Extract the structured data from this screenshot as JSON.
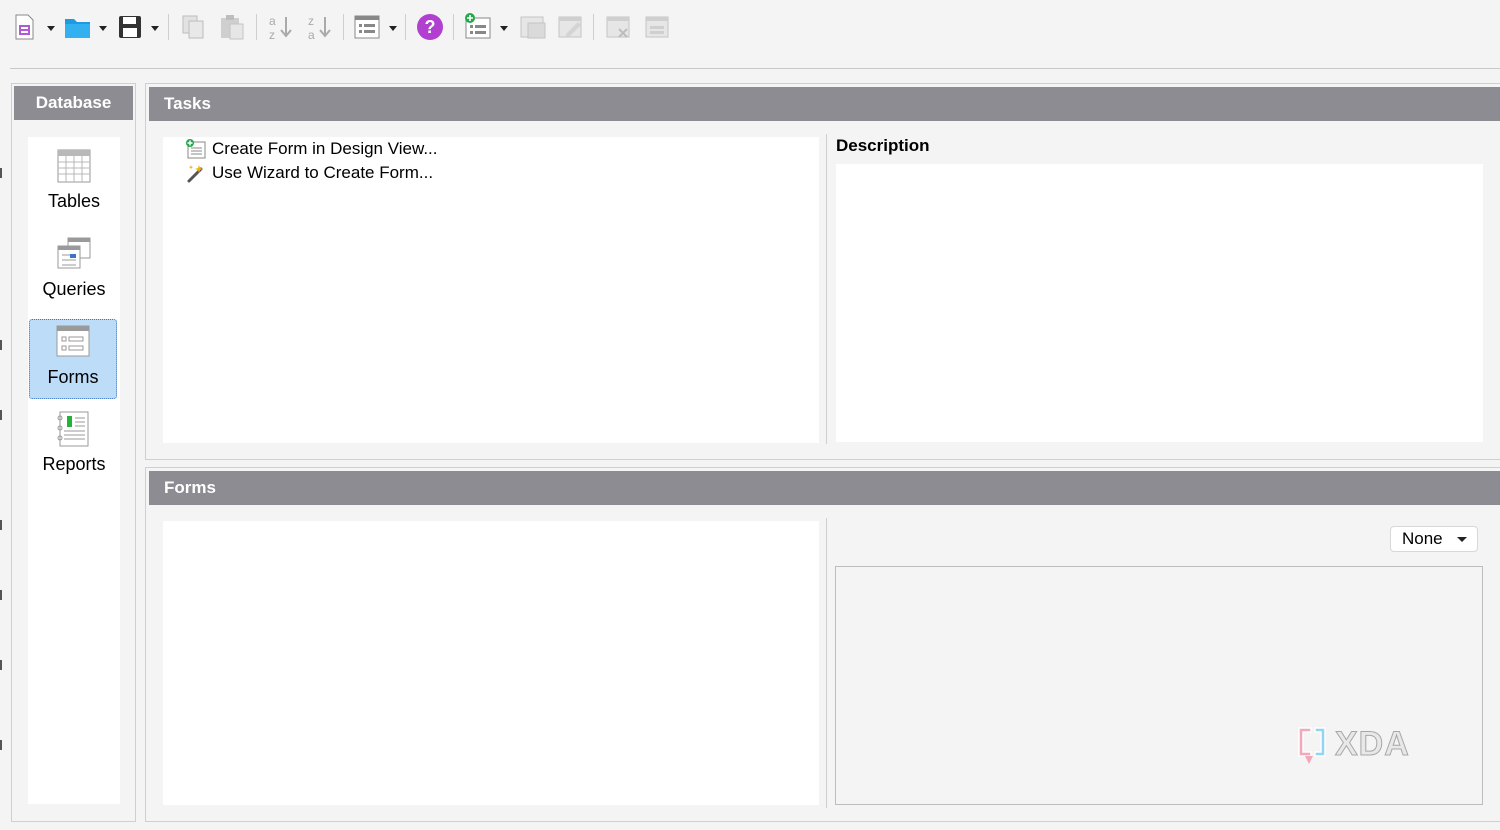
{
  "toolbar": {
    "buttons": [
      {
        "name": "new-document",
        "icon": "new-document-icon",
        "has_dropdown": true
      },
      {
        "name": "open",
        "icon": "folder-icon",
        "has_dropdown": true
      },
      {
        "name": "save",
        "icon": "floppy-disk-icon",
        "has_dropdown": true
      },
      {
        "name": "copy",
        "icon": "copy-icon",
        "enabled": false
      },
      {
        "name": "paste",
        "icon": "paste-icon",
        "enabled": false
      },
      {
        "name": "sort-ascending",
        "icon": "sort-az-icon",
        "enabled": false
      },
      {
        "name": "sort-descending",
        "icon": "sort-za-icon",
        "enabled": false
      },
      {
        "name": "new-form",
        "icon": "form-icon",
        "has_dropdown": true
      },
      {
        "name": "help",
        "icon": "help-icon"
      },
      {
        "name": "new-form-object",
        "icon": "form-add-icon",
        "has_dropdown": true
      },
      {
        "name": "open-form",
        "icon": "form-open-icon",
        "enabled": false
      },
      {
        "name": "edit-form",
        "icon": "form-edit-icon",
        "enabled": false
      },
      {
        "name": "delete-form",
        "icon": "form-delete-icon",
        "enabled": false
      },
      {
        "name": "rename-form",
        "icon": "form-rename-icon",
        "enabled": false
      }
    ]
  },
  "database": {
    "title": "Database",
    "items": [
      {
        "label": "Tables",
        "icon": "table-icon",
        "selected": false
      },
      {
        "label": "Queries",
        "icon": "query-icon",
        "selected": false
      },
      {
        "label": "Forms",
        "icon": "form-icon",
        "selected": true
      },
      {
        "label": "Reports",
        "icon": "report-icon",
        "selected": false
      }
    ]
  },
  "tasks": {
    "title": "Tasks",
    "items": [
      {
        "label": "Create Form in Design View...",
        "icon": "form-design-icon"
      },
      {
        "label": "Use Wizard to Create Form...",
        "icon": "wizard-wand-icon"
      }
    ],
    "description_title": "Description"
  },
  "forms": {
    "title": "Forms",
    "preview_select": "None"
  },
  "watermark": "XDA",
  "colors": {
    "header_bar": "#8d8c93",
    "selection_fill": "#bcdcf7",
    "selection_border": "#3b74c0",
    "help_purple": "#b13fd0",
    "folder_blue": "#1e9be0"
  }
}
